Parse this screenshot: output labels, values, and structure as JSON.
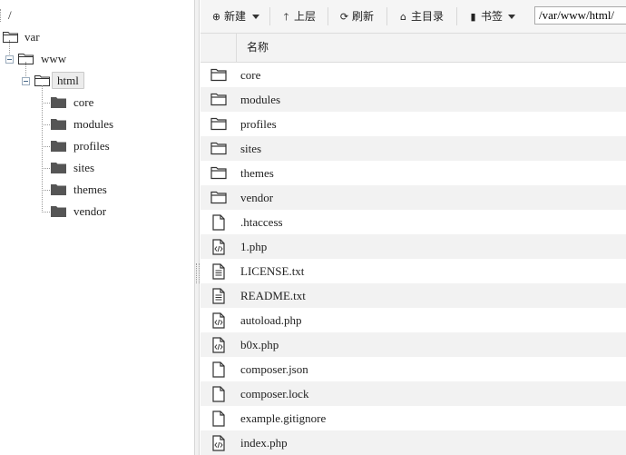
{
  "tree": {
    "root_label": "/",
    "nodes": [
      {
        "label": "var"
      },
      {
        "label": "www"
      },
      {
        "label": "html"
      }
    ],
    "children": [
      {
        "label": "core"
      },
      {
        "label": "modules"
      },
      {
        "label": "profiles"
      },
      {
        "label": "sites"
      },
      {
        "label": "themes"
      },
      {
        "label": "vendor"
      }
    ]
  },
  "toolbar": {
    "new_label": "新建",
    "up_label": "上层",
    "refresh_label": "刷新",
    "home_label": "主目录",
    "bookmark_label": "书签",
    "path_value": "/var/www/html/"
  },
  "list": {
    "name_header": "名称",
    "files": [
      {
        "name": "core",
        "icon": "folder-icon"
      },
      {
        "name": "modules",
        "icon": "folder-icon"
      },
      {
        "name": "profiles",
        "icon": "folder-icon"
      },
      {
        "name": "sites",
        "icon": "folder-icon"
      },
      {
        "name": "themes",
        "icon": "folder-icon"
      },
      {
        "name": "vendor",
        "icon": "folder-icon"
      },
      {
        "name": ".htaccess",
        "icon": "file-icon"
      },
      {
        "name": "1.php",
        "icon": "code-file-icon"
      },
      {
        "name": "LICENSE.txt",
        "icon": "text-file-icon"
      },
      {
        "name": "README.txt",
        "icon": "text-file-icon"
      },
      {
        "name": "autoload.php",
        "icon": "code-file-icon"
      },
      {
        "name": "b0x.php",
        "icon": "code-file-icon"
      },
      {
        "name": "composer.json",
        "icon": "file-icon"
      },
      {
        "name": "composer.lock",
        "icon": "file-icon"
      },
      {
        "name": "example.gitignore",
        "icon": "file-icon"
      },
      {
        "name": "index.php",
        "icon": "code-file-icon"
      }
    ]
  },
  "colors": {
    "toolbar_bg": "#f5f5f5",
    "row_alt_bg": "#f2f2f2",
    "selected_node_bg": "#ececec"
  }
}
